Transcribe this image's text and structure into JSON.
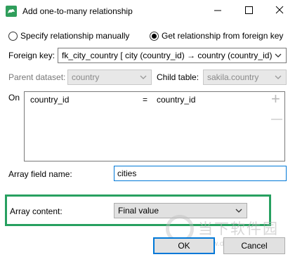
{
  "window": {
    "title": "Add one-to-many relationship"
  },
  "mode": {
    "manual_label": "Specify relationship manually",
    "foreign_key_label": "Get relationship from foreign key",
    "selected": "foreign_key"
  },
  "foreign_key": {
    "label": "Foreign key:",
    "value": "fk_city_country [ city (country_id) → country (country_id)"
  },
  "parent_dataset": {
    "label": "Parent dataset:",
    "value": "country"
  },
  "child_table": {
    "label": "Child table:",
    "value": "sakila.country"
  },
  "join": {
    "on_label": "On",
    "left": "country_id",
    "operator": "=",
    "right": "country_id",
    "add_glyph": "+",
    "remove_glyph": "—"
  },
  "array_field": {
    "label": "Array field name:",
    "value": "cities"
  },
  "array_content": {
    "label": "Array content:",
    "value": "Final value"
  },
  "buttons": {
    "ok": "OK",
    "cancel": "Cancel"
  },
  "watermark": {
    "text": "当下软件园",
    "url": "www.downxia.com"
  },
  "colors": {
    "accent": "#0078d7",
    "highlight": "#27a060",
    "app_icon": "#2f9e5b"
  }
}
